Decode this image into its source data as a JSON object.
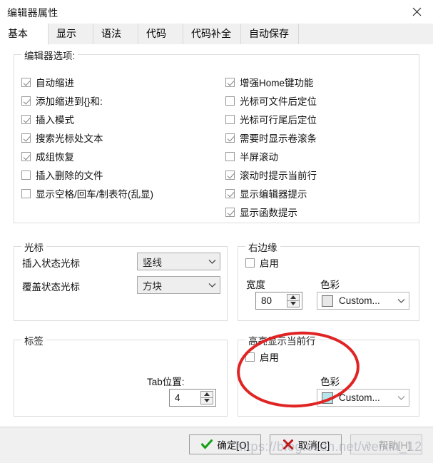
{
  "window": {
    "title": "编辑器属性",
    "close_label": "✕"
  },
  "tabs": [
    {
      "label": "基本",
      "active": true
    },
    {
      "label": "显示",
      "active": false
    },
    {
      "label": "语法",
      "active": false
    },
    {
      "label": "代码",
      "active": false
    },
    {
      "label": "代码补全",
      "active": false
    },
    {
      "label": "自动保存",
      "active": false
    }
  ],
  "editor_options": {
    "title": "编辑器选项:",
    "left_column": [
      {
        "label": "自动缩进",
        "checked": true
      },
      {
        "label": "添加缩进到{}和:",
        "checked": true
      },
      {
        "label": "插入模式",
        "checked": true
      },
      {
        "label": "搜索光标处文本",
        "checked": true
      },
      {
        "label": "成组恢复",
        "checked": true
      },
      {
        "label": "插入删除的文件",
        "checked": false
      },
      {
        "label": "显示空格/回车/制表符(乱显)",
        "checked": false
      }
    ],
    "right_column": [
      {
        "label": "增强Home键功能",
        "checked": true
      },
      {
        "label": "光标可文件后定位",
        "checked": false
      },
      {
        "label": "光标可行尾后定位",
        "checked": false
      },
      {
        "label": "需要时显示卷滚条",
        "checked": true
      },
      {
        "label": "半屏滚动",
        "checked": false
      },
      {
        "label": "滚动时提示当前行",
        "checked": true
      },
      {
        "label": "显示编辑器提示",
        "checked": true
      },
      {
        "label": "显示函数提示",
        "checked": true
      }
    ]
  },
  "cursor_group": {
    "title": "光标",
    "insert_label": "插入状态光标",
    "insert_value": "竖线",
    "overwrite_label": "覆盖状态光标",
    "overwrite_value": "方块"
  },
  "right_margin_group": {
    "title": "右边缘",
    "enable_label": "启用",
    "enable_checked": false,
    "width_label": "宽度",
    "width_value": "80",
    "color_label": "色彩",
    "color_value": "Custom...",
    "color_swatch": "#e8e8e8"
  },
  "tab_group": {
    "title": "标签",
    "tabpos_label": "Tab位置:",
    "tabpos_value": "4"
  },
  "highlight_group": {
    "title": "高亮显示当前行",
    "enable_label": "启用",
    "enable_checked": false,
    "color_label": "色彩",
    "color_value": "Custom...",
    "color_swatch": "#b5e6ec"
  },
  "footer": {
    "ok_label": "确定[O]",
    "cancel_label": "取消[C]",
    "help_label": "帮助[H]",
    "ok_icon_color": "#1a9c1a",
    "cancel_icon_color": "#cc1111"
  },
  "annotation": {
    "shape": "red-ellipse",
    "color": "#e02020"
  },
  "watermark": {
    "text": "https://blog.csdn.net/weixin_12"
  }
}
